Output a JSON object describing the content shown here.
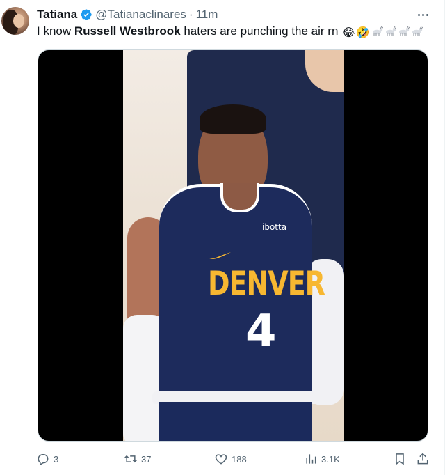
{
  "author": {
    "name": "Tatiana",
    "handle": "@Tatianaclinares",
    "separator": "·",
    "time": "11m"
  },
  "tweet": {
    "text_before": "I know ",
    "text_bold": "Russell Westbrook",
    "text_after": " haters are punching the air rn",
    "emoji_1": "😂",
    "emoji_2": "🤣"
  },
  "media": {
    "jersey_sponsor": "ibotta",
    "jersey_team": "DENVER",
    "jersey_number": "4"
  },
  "actions": {
    "replies": "3",
    "reposts": "37",
    "likes": "188",
    "views": "3.1K"
  },
  "colors": {
    "verified_badge": "#1d9bf0",
    "secondary_text": "#536471",
    "jersey_navy": "#1d2b5c",
    "jersey_gold": "#f7b731"
  },
  "icons": [
    "verified-badge-icon",
    "more-icon",
    "goat-icon",
    "reply-icon",
    "repost-icon",
    "like-icon",
    "views-icon",
    "bookmark-icon",
    "share-icon"
  ]
}
